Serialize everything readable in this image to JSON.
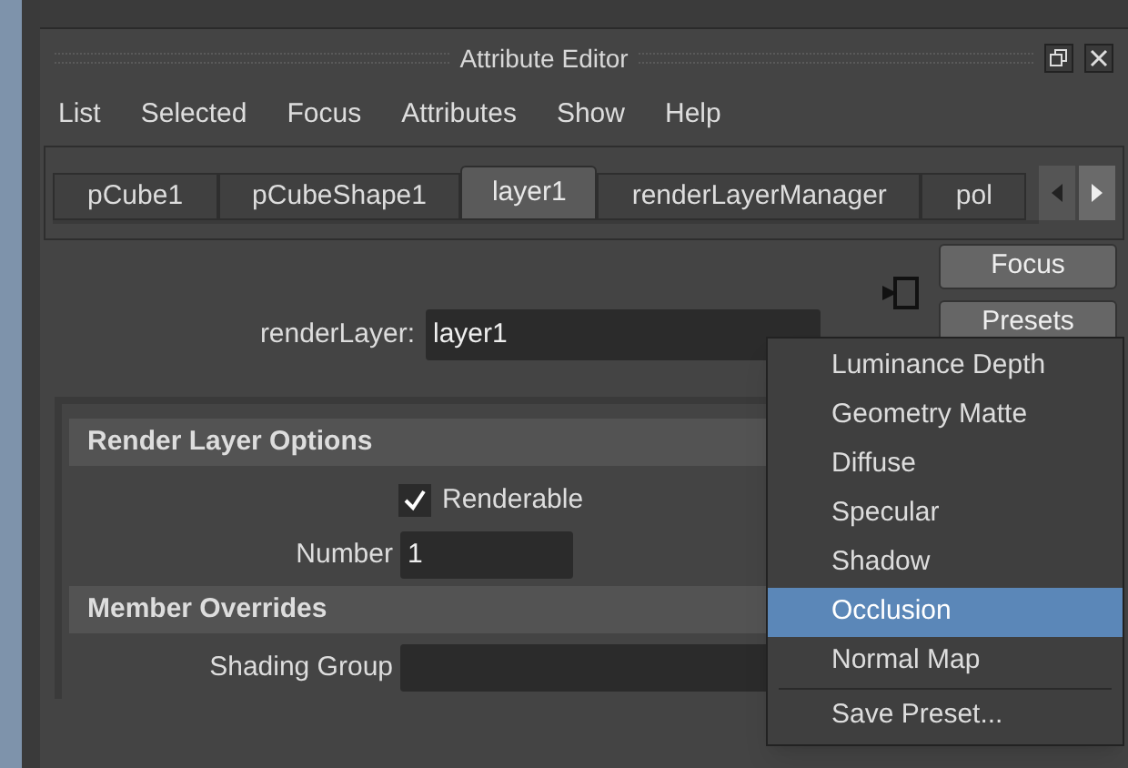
{
  "window": {
    "title": "Attribute Editor"
  },
  "menu": [
    "List",
    "Selected",
    "Focus",
    "Attributes",
    "Show",
    "Help"
  ],
  "tabs": [
    {
      "label": "pCube1",
      "selected": false
    },
    {
      "label": "pCubeShape1",
      "selected": false
    },
    {
      "label": "layer1",
      "selected": true
    },
    {
      "label": "renderLayerManager",
      "selected": false
    },
    {
      "label": "pol",
      "selected": false
    }
  ],
  "buttons": [
    "Focus",
    "Presets"
  ],
  "render_layer": {
    "label": "renderLayer:",
    "value": "layer1"
  },
  "sections": [
    {
      "title": "Render Layer Options",
      "fields": [
        {
          "kind": "checkbox",
          "label": "Renderable",
          "checked": true
        },
        {
          "kind": "text",
          "label": "Number",
          "value": "1"
        }
      ]
    },
    {
      "title": "Member Overrides",
      "fields": [
        {
          "kind": "text",
          "label": "Shading Group"
        }
      ]
    }
  ],
  "presets_menu": {
    "items": [
      {
        "label": "Luminance Depth",
        "selected": false
      },
      {
        "label": "Geometry Matte",
        "selected": false
      },
      {
        "label": "Diffuse",
        "selected": false
      },
      {
        "label": "Specular",
        "selected": false
      },
      {
        "label": "Shadow",
        "selected": false
      },
      {
        "label": "Occlusion",
        "selected": true
      },
      {
        "label": "Normal Map",
        "selected": false
      }
    ],
    "footer": "Save Preset..."
  }
}
